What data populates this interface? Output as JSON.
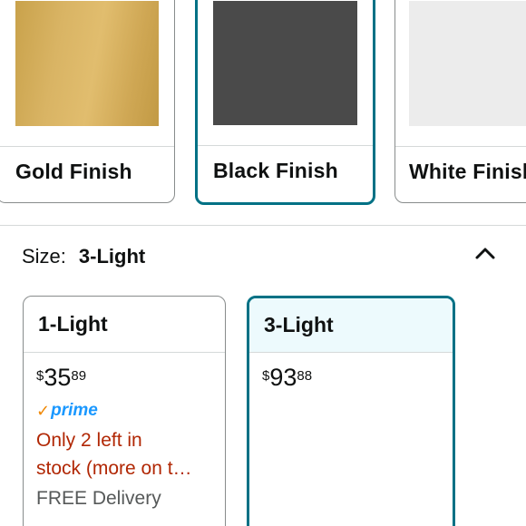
{
  "colors": {
    "accent": "#007185",
    "selected_header_bg": "#edfafd",
    "stock_warning": "#b12704",
    "prime_blue": "#1a98ff",
    "prime_check": "#f08804",
    "muted_text": "#565959",
    "card_border": "#888c8c"
  },
  "color_swatches": [
    {
      "label": "Gold Finish",
      "selected": false
    },
    {
      "label": "Black Finish",
      "selected": true
    },
    {
      "label": "White Finish",
      "selected": false
    }
  ],
  "size": {
    "key_label": "Size:",
    "selected_value": "3-Light",
    "collapse_icon": "chevron-up-icon",
    "options": [
      {
        "label": "1-Light",
        "selected": false,
        "price": {
          "symbol": "$",
          "whole": "35",
          "fraction": "89"
        },
        "prime_label": "prime",
        "prime_check": "✓",
        "stock_line1": "Only 2 left in",
        "stock_line2": "stock (more on t…",
        "delivery": "FREE Delivery"
      },
      {
        "label": "3-Light",
        "selected": true,
        "price": {
          "symbol": "$",
          "whole": "93",
          "fraction": "88"
        }
      }
    ]
  }
}
